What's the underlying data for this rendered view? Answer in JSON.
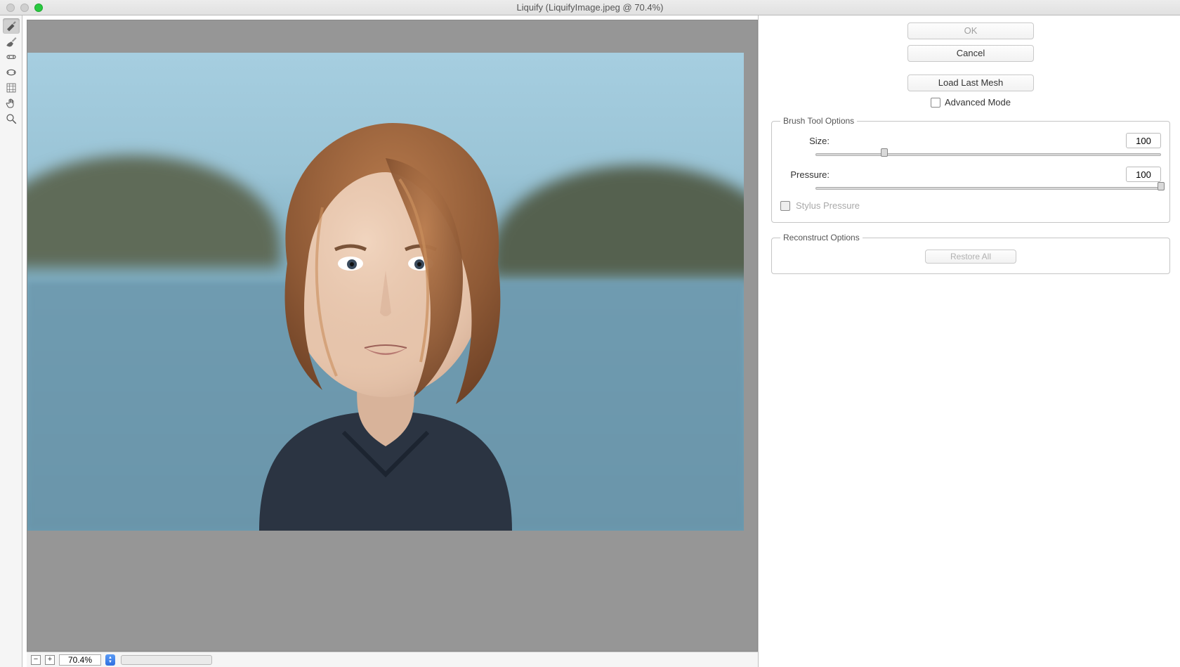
{
  "window": {
    "title": "Liquify (LiquifyImage.jpeg @ 70.4%)"
  },
  "zoom": {
    "value": "70.4%"
  },
  "tools": [
    {
      "name": "forward-warp-tool",
      "active": true
    },
    {
      "name": "reconstruct-tool",
      "active": false
    },
    {
      "name": "pucker-tool",
      "active": false
    },
    {
      "name": "bloat-tool",
      "active": false
    },
    {
      "name": "push-left-tool",
      "active": false
    },
    {
      "name": "hand-tool",
      "active": false
    },
    {
      "name": "zoom-tool",
      "active": false
    }
  ],
  "buttons": {
    "ok": "OK",
    "cancel": "Cancel",
    "load_last_mesh": "Load Last Mesh",
    "restore_all": "Restore All"
  },
  "checkboxes": {
    "advanced_mode": "Advanced Mode",
    "stylus_pressure": "Stylus Pressure"
  },
  "groups": {
    "brush_tool_options": "Brush Tool Options",
    "reconstruct_options": "Reconstruct Options"
  },
  "brush": {
    "size_label": "Size:",
    "size_value": "100",
    "size_percent": 20,
    "pressure_label": "Pressure:",
    "pressure_value": "100",
    "pressure_percent": 100
  }
}
